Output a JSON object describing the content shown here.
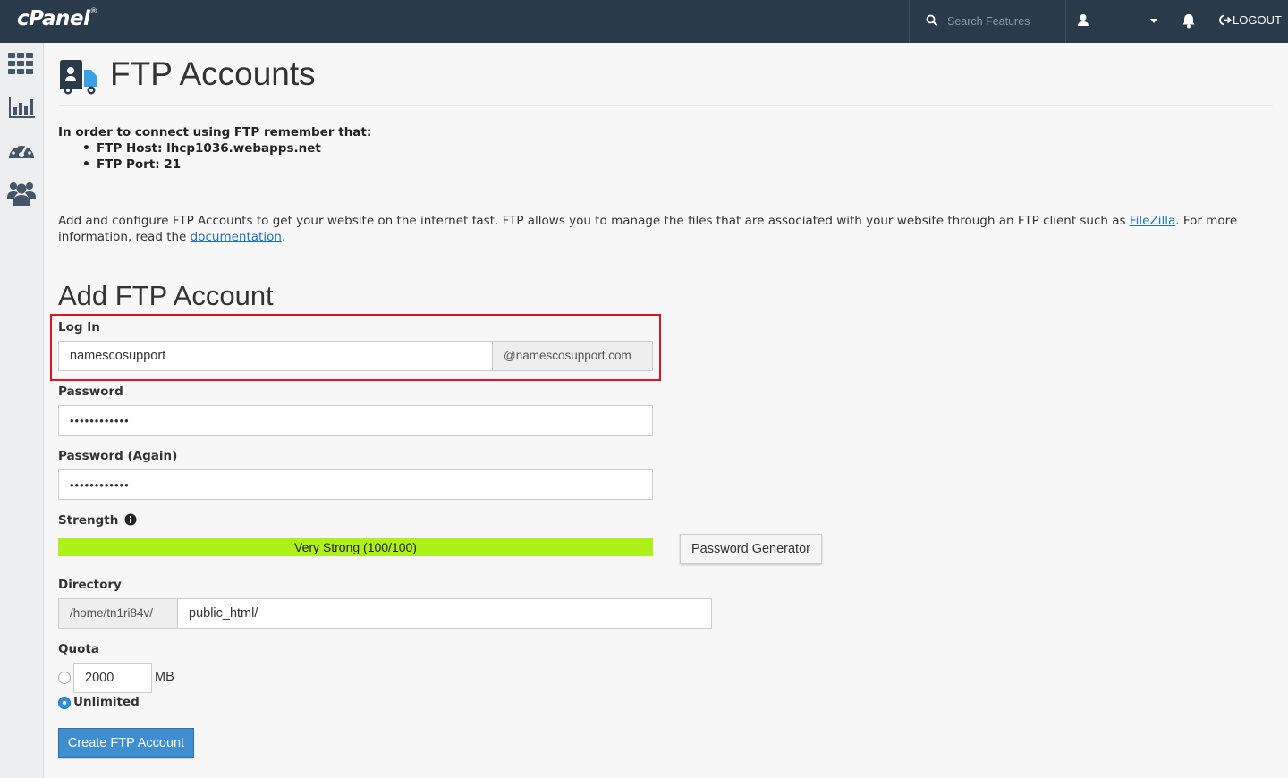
{
  "topbar": {
    "logo": "cPanel",
    "logo_mark": "®",
    "search_placeholder": "Search Features",
    "logout_label": "LOGOUT"
  },
  "sidebar": {
    "items": [
      {
        "name": "grid-icon"
      },
      {
        "name": "bar-chart-icon"
      },
      {
        "name": "dashboard-gauge-icon"
      },
      {
        "name": "users-icon"
      }
    ]
  },
  "page": {
    "title": "FTP Accounts",
    "notice": {
      "heading": "In order to connect using FTP remember that:",
      "host": "FTP Host: lhcp1036.webapps.net",
      "port": "FTP Port: 21"
    },
    "intro": {
      "text_before": "Add and configure FTP Accounts to get your website on the internet fast. FTP allows you to manage the files that are associated with your website through an FTP client such as ",
      "link1": "FileZilla",
      "text_middle": ". For more information, read the ",
      "link2": "documentation",
      "text_after": "."
    }
  },
  "form": {
    "section_title": "Add FTP Account",
    "login_label": "Log In",
    "login_value": "namescosupport",
    "login_domain": "@namescosupport.com",
    "password_label": "Password",
    "password_value": "••••••••••••",
    "password_again_label": "Password (Again)",
    "password_again_value": "••••••••••••",
    "strength_label": "Strength",
    "strength_text": "Very Strong (100/100)",
    "strength_score": 100,
    "password_generator_label": "Password Generator",
    "directory_label": "Directory",
    "directory_prefix": "/home/tn1ri84v/",
    "directory_value": "public_html/",
    "quota_label": "Quota",
    "quota_value": "2000",
    "quota_unit": "MB",
    "unlimited_label": "Unlimited",
    "quota_selected": "unlimited",
    "submit_label": "Create FTP Account"
  },
  "colors": {
    "topbar": "#293a4a",
    "highlight": "#e1121c",
    "strength_bar": "#aef01a",
    "primary_button": "#3e8ed0",
    "link": "#1e73be"
  }
}
